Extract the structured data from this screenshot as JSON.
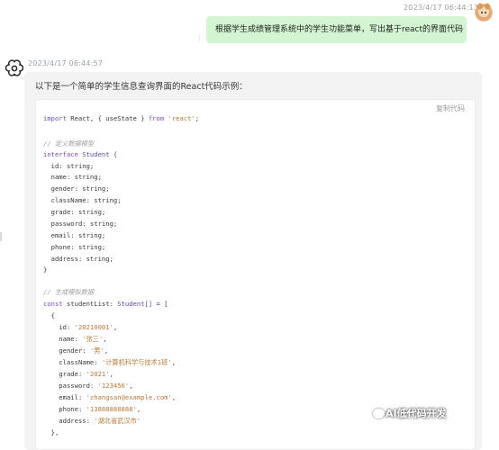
{
  "user_message": {
    "timestamp": "2023/4/17 06:44:13",
    "text": "根据学生成绩管理系统中的学生功能菜单，写出基于react的界面代码"
  },
  "bot_message": {
    "timestamp": "2023/4/17 06:44:57",
    "intro": "以下是一个简单的学生信息查询界面的React代码示例：",
    "copy_label": "复制代码"
  },
  "code": {
    "import_kw": "import",
    "import_body": " React, { useState } ",
    "from_kw": "from",
    "import_src": "'react'",
    "import_end": ";",
    "comment_model": "// 定义数据模型",
    "interface_kw": "interface",
    "interface_name": " Student {",
    "fields": [
      "  id: string;",
      "  name: string;",
      "  gender: string;",
      "  className: string;",
      "  grade: string;",
      "  password: string;",
      "  email: string;",
      "  phone: string;",
      "  address: string;"
    ],
    "close_brace": "}",
    "comment_mock": "// 生成模拟数据",
    "const_kw": "const",
    "const_decl": " studentList: ",
    "const_type": "Student[]",
    "const_rest": " = [",
    "obj_open": "  {",
    "entries": [
      {
        "key": "    id: ",
        "val": "'20210001'",
        "end": ","
      },
      {
        "key": "    name: ",
        "val": "'张三'",
        "end": ","
      },
      {
        "key": "    gender: ",
        "val": "'男'",
        "end": ","
      },
      {
        "key": "    className: ",
        "val": "'计算机科学与技术1班'",
        "end": ","
      },
      {
        "key": "    grade: ",
        "val": "'2021'",
        "end": ","
      },
      {
        "key": "    password: ",
        "val": "'123456'",
        "end": ","
      },
      {
        "key": "    email: ",
        "val": "'zhangsan@example.com'",
        "end": ","
      },
      {
        "key": "    phone: ",
        "val": "'13888888888'",
        "end": ","
      },
      {
        "key": "    address: ",
        "val": "'湖北省武汉市'",
        "end": ""
      }
    ],
    "obj_close": "  },"
  },
  "watermark": "AI低代码开发"
}
